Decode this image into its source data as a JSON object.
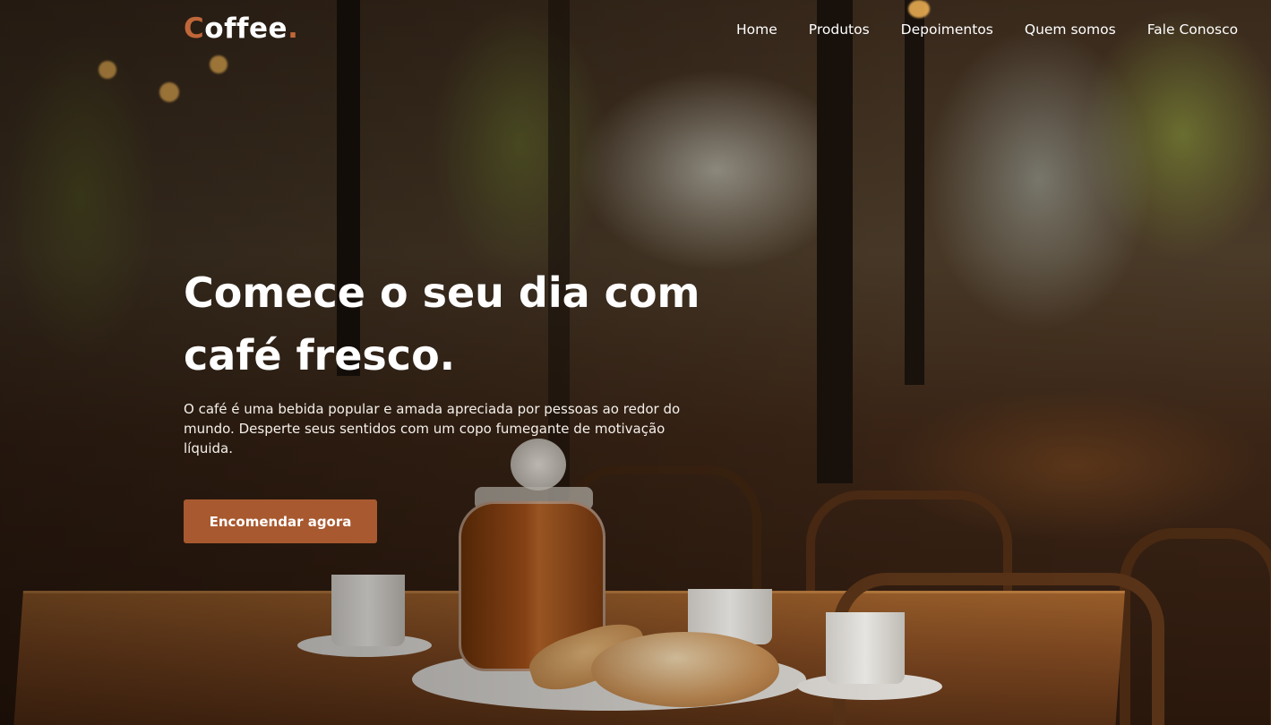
{
  "brand": {
    "logo_first": "C",
    "logo_rest": "offee",
    "logo_dot": ".",
    "accent_color": "#c0673a"
  },
  "nav": {
    "items": [
      {
        "label": "Home"
      },
      {
        "label": "Produtos"
      },
      {
        "label": "Depoimentos"
      },
      {
        "label": "Quem somos"
      },
      {
        "label": "Fale Conosco"
      }
    ]
  },
  "hero": {
    "title_line1": "Comece o seu dia com",
    "title_line2": "café fresco.",
    "description": "O café é uma bebida popular e amada apreciada por pessoas ao redor do mundo. Desperte seus sentidos com um copo fumegante de motivação líquida.",
    "cta_label": "Encomendar agora",
    "cta_color": "#a8592f",
    "background_image": "coffee-shop-table-with-cups-jar-and-pastries"
  }
}
